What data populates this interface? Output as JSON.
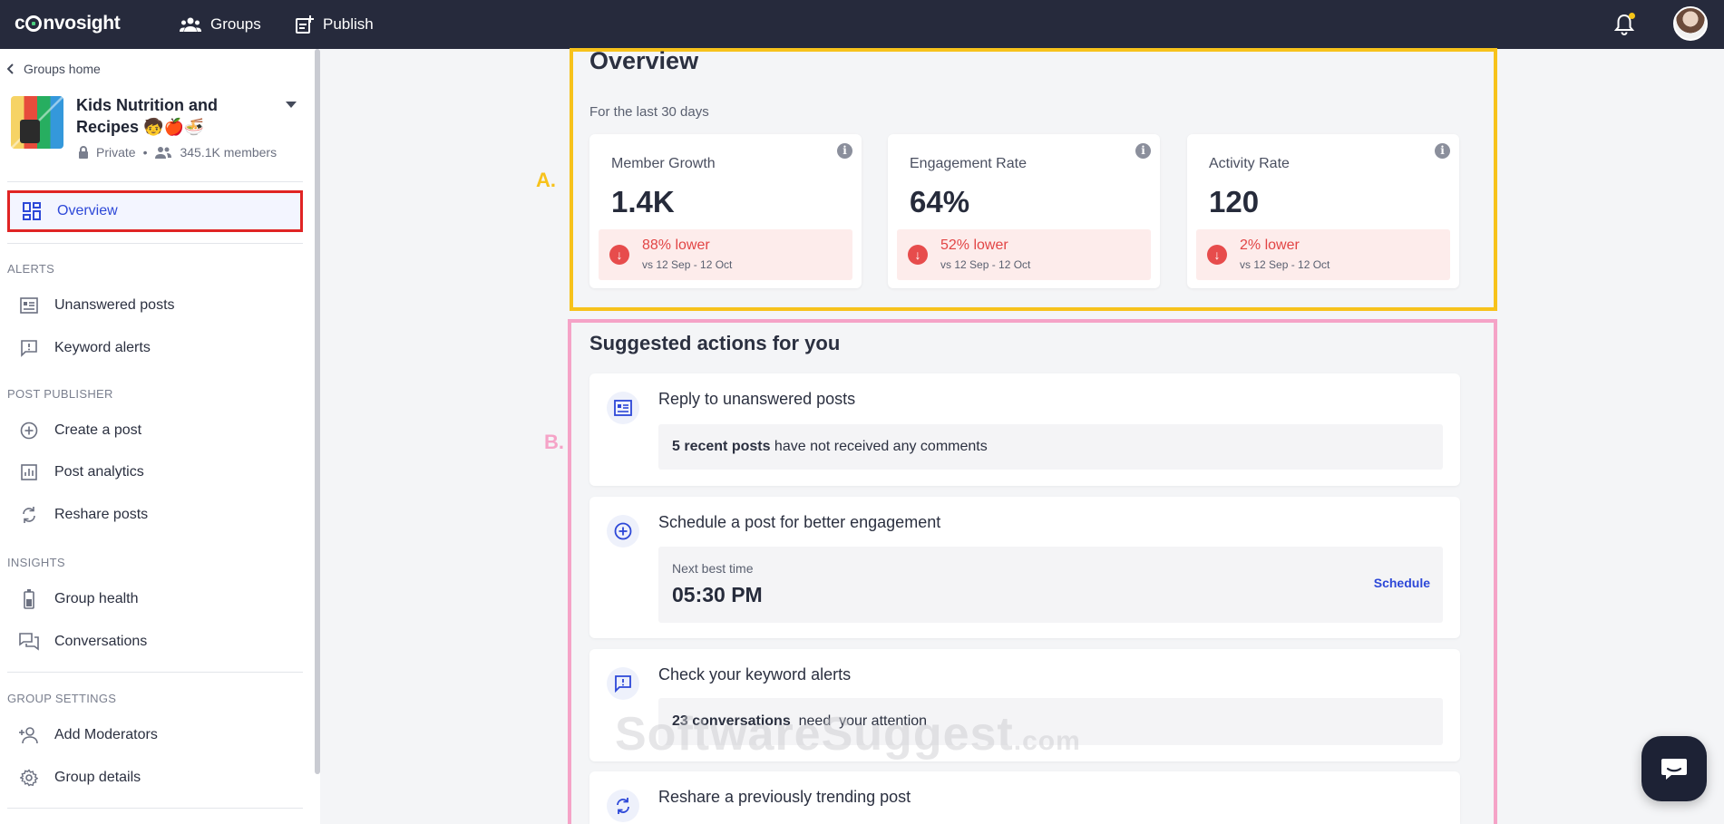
{
  "topbar": {
    "logo_text": "convosight",
    "nav": [
      {
        "label": "Groups",
        "icon": "groups-icon"
      },
      {
        "label": "Publish",
        "icon": "publish-icon"
      }
    ],
    "notification_dot_color": "#f5c518"
  },
  "sidebar": {
    "back_label": "Groups home",
    "group": {
      "name": "Kids Nutrition and Recipes 🧒🍎🍜",
      "privacy": "Private",
      "separator": "•",
      "members": "345.1K members"
    },
    "active_item": {
      "label": "Overview",
      "icon": "dashboard-icon"
    },
    "sections": [
      {
        "title": "ALERTS",
        "items": [
          {
            "label": "Unanswered posts",
            "icon": "post-list-icon"
          },
          {
            "label": "Keyword alerts",
            "icon": "alert-message-icon"
          }
        ]
      },
      {
        "title": "POST PUBLISHER",
        "items": [
          {
            "label": "Create a post",
            "icon": "add-circle-icon"
          },
          {
            "label": "Post analytics",
            "icon": "bar-chart-icon"
          },
          {
            "label": "Reshare posts",
            "icon": "reshare-icon"
          }
        ]
      },
      {
        "title": "INSIGHTS",
        "items": [
          {
            "label": "Group health",
            "icon": "battery-icon"
          },
          {
            "label": "Conversations",
            "icon": "conversations-icon"
          }
        ]
      },
      {
        "title": "GROUP SETTINGS",
        "items": [
          {
            "label": "Add Moderators",
            "icon": "add-user-icon"
          },
          {
            "label": "Group details",
            "icon": "gear-icon"
          }
        ]
      }
    ]
  },
  "annotations": {
    "a": "A.",
    "b": "B.",
    "a_color": "#f7c21b",
    "b_color": "#f5a3c7",
    "highlight_color": "#e02424"
  },
  "overview": {
    "title": "Overview",
    "subtitle": "For the last 30 days",
    "metrics": [
      {
        "label": "Member Growth",
        "value": "1.4K",
        "delta": "88% lower",
        "period": "vs 12 Sep - 12 Oct"
      },
      {
        "label": "Engagement Rate",
        "value": "64%",
        "delta": "52% lower",
        "period": "vs 12 Sep - 12 Oct"
      },
      {
        "label": "Activity Rate",
        "value": "120",
        "delta": "2% lower",
        "period": "vs 12 Sep - 12 Oct"
      }
    ]
  },
  "suggested": {
    "title": "Suggested actions for you",
    "cards": [
      {
        "title": "Reply to unanswered posts",
        "bold": "5 recent posts",
        "rest": " have not received any comments",
        "icon": "post-list-icon"
      },
      {
        "title": "Schedule a post for better engagement",
        "next_label": "Next best time",
        "next_value": "05:30 PM",
        "action": "Schedule",
        "icon": "add-circle-icon"
      },
      {
        "title": "Check your keyword alerts",
        "bold": "23 conversations",
        "rest": "  need  your attention",
        "icon": "alert-message-icon"
      },
      {
        "title": "Reshare a previously trending post",
        "icon": "reshare-icon"
      }
    ]
  },
  "watermark": {
    "main": "SoftwareSuggest",
    "suffix": ".com"
  }
}
